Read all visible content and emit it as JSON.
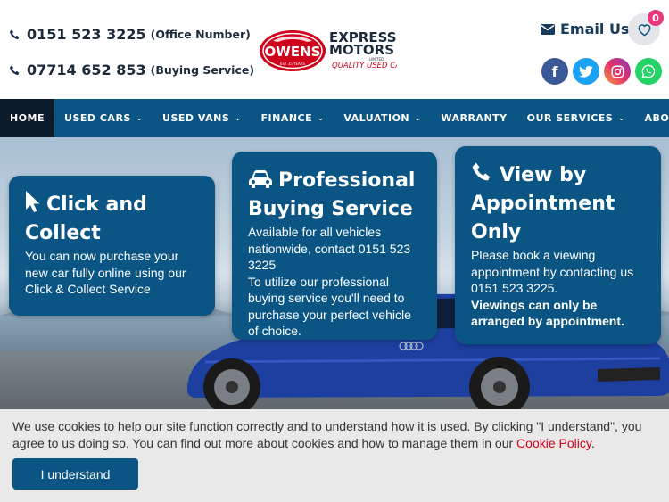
{
  "header": {
    "phone_office": {
      "number": "0151 523 3225",
      "note": "(Office Number)"
    },
    "phone_buying": {
      "number": "07714 652 853",
      "note": "(Buying Service)"
    },
    "logo": {
      "owens": "OWENS",
      "est": "EST 35 YEARS",
      "express": "EXPRESS",
      "motors": "MOTORS",
      "limited": "LIMITED",
      "tagline": "QUALITY USED CARS"
    },
    "email_label": "Email Us",
    "favorites_count": "0",
    "social": [
      {
        "name": "facebook",
        "glyph": "f"
      },
      {
        "name": "twitter"
      },
      {
        "name": "instagram"
      },
      {
        "name": "whatsapp"
      }
    ]
  },
  "nav": {
    "items": [
      {
        "label": "HOME",
        "active": true,
        "dropdown": false
      },
      {
        "label": "USED CARS",
        "dropdown": true
      },
      {
        "label": "USED VANS",
        "dropdown": true
      },
      {
        "label": "FINANCE",
        "dropdown": true
      },
      {
        "label": "VALUATION",
        "dropdown": true
      },
      {
        "label": "WARRANTY",
        "dropdown": false
      },
      {
        "label": "OUR SERVICES",
        "dropdown": true
      },
      {
        "label": "ABOUT",
        "dropdown": true
      }
    ],
    "chevron": "⌄"
  },
  "hero": {
    "cards": [
      {
        "icon": "cursor-icon",
        "title_line1": "Click and",
        "title_line2": "Collect",
        "body": "You can now purchase your new car fully online using our Click & Collect Service"
      },
      {
        "icon": "car-icon",
        "title_line1": "Professional",
        "title_line2": "Buying Service",
        "body1": "Available for all vehicles nationwide, contact 0151 523 3225",
        "body2": "To utilize our professional buying service you'll need to purchase your perfect vehicle of choice."
      },
      {
        "icon": "phone-icon",
        "title_line1": "View by",
        "title_line2": "Appointment",
        "title_line3": "Only",
        "body": "Please book a viewing appointment by contacting us 0151 523 3225.",
        "strong": "Viewings can only be arranged by appointment."
      }
    ]
  },
  "cookie": {
    "text": "We use cookies to help our site function correctly and to understand how it is used. By clicking \"I understand\", you agree to us doing so. You can find out more about cookies and how to manage them in our",
    "link": "Cookie Policy",
    "end": ".",
    "button": "I understand"
  },
  "colors": {
    "brand_blue": "#0a5584",
    "nav_active": "#0b1b2b",
    "badge_pink": "#e8397d",
    "logo_red": "#d0021b"
  }
}
